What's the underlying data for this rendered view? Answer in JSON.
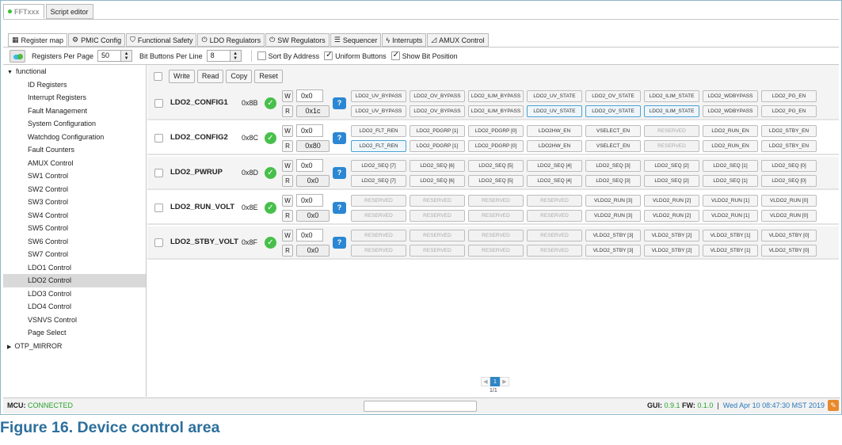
{
  "window": {
    "top_tabs": [
      {
        "label": "Script editor"
      }
    ],
    "top_tab_blurred_label": "FFTxxx"
  },
  "main_tabs": [
    {
      "icon": "grid-icon",
      "label": "Register map"
    },
    {
      "icon": "gear-icon",
      "label": "PMIC Config"
    },
    {
      "icon": "shield-icon",
      "label": "Functional Safety"
    },
    {
      "icon": "power-icon",
      "label": "LDO Regulators"
    },
    {
      "icon": "power-icon",
      "label": "SW Regulators"
    },
    {
      "icon": "list-icon",
      "label": "Sequencer"
    },
    {
      "icon": "lightning-icon",
      "label": "Interrupts"
    },
    {
      "icon": "graph-icon",
      "label": "AMUX Control"
    }
  ],
  "toolbar": {
    "registers_per_page_label": "Registers Per Page",
    "registers_per_page_value": "50",
    "bit_buttons_label": "Bit Buttons Per Line",
    "bit_buttons_value": "8",
    "sort_by_address": "Sort By Address",
    "uniform_buttons": "Uniform Buttons",
    "show_bit_position": "Show Bit Position"
  },
  "tree": {
    "root": "functional",
    "children": [
      "ID Registers",
      "Interrupt Registers",
      "Fault Management",
      "System Configuration",
      "Watchdog Configuration",
      "Fault Counters",
      "AMUX Control",
      "SW1 Control",
      "SW2 Control",
      "SW3 Control",
      "SW4 Control",
      "SW5 Control",
      "SW6 Control",
      "SW7 Control",
      "LDO1 Control",
      "LDO2 Control",
      "LDO3 Control",
      "LDO4 Control",
      "VSNVS Control",
      "Page Select"
    ],
    "selected": "LDO2 Control",
    "root2": "OTP_MIRROR"
  },
  "actions": {
    "write": "Write",
    "read": "Read",
    "copy": "Copy",
    "reset": "Reset"
  },
  "registers": [
    {
      "name": "LDO2_CONFIG1",
      "addr": "0x8B",
      "w": "0x0",
      "r": "0x1c",
      "bits_w": [
        "LDO2_UV_BYPASS",
        "LDO2_OV_BYPASS",
        "LDO2_ILIM_BYPASS",
        "LDO2_UV_STATE",
        "LDO2_OV_STATE",
        "LDO2_ILIM_STATE",
        "LDO2_WDBYPASS",
        "LDO2_PG_EN"
      ],
      "bits_r": [
        "LDO2_UV_BYPASS",
        "LDO2_OV_BYPASS",
        "LDO2_ILIM_BYPASS",
        "LDO2_UV_STATE",
        "LDO2_OV_STATE",
        "LDO2_ILIM_STATE",
        "LDO2_WDBYPASS",
        "LDO2_PG_EN"
      ],
      "hl_r": [
        3,
        4,
        5
      ]
    },
    {
      "name": "LDO2_CONFIG2",
      "addr": "0x8C",
      "w": "0x0",
      "r": "0x80",
      "bits_w": [
        "LDO2_FLT_REN",
        "LDO2_PDGRP [1]",
        "LDO2_PDGRP [0]",
        "LDO2HW_EN",
        "VSELECT_EN",
        "RESERVED",
        "LDO2_RUN_EN",
        "LDO2_STBY_EN"
      ],
      "bits_r": [
        "LDO2_FLT_REN",
        "LDO2_PDGRP [1]",
        "LDO2_PDGRP [0]",
        "LDO2HW_EN",
        "VSELECT_EN",
        "RESERVED",
        "LDO2_RUN_EN",
        "LDO2_STBY_EN"
      ],
      "hl_r": [
        0
      ]
    },
    {
      "name": "LDO2_PWRUP",
      "addr": "0x8D",
      "w": "0x0",
      "r": "0x0",
      "bits_w": [
        "LDO2_SEQ [7]",
        "LDO2_SEQ [6]",
        "LDO2_SEQ [5]",
        "LDO2_SEQ [4]",
        "LDO2_SEQ [3]",
        "LDO2_SEQ [2]",
        "LDO2_SEQ [1]",
        "LDO2_SEQ [0]"
      ],
      "bits_r": [
        "LDO2_SEQ [7]",
        "LDO2_SEQ [6]",
        "LDO2_SEQ [5]",
        "LDO2_SEQ [4]",
        "LDO2_SEQ [3]",
        "LDO2_SEQ [2]",
        "LDO2_SEQ [1]",
        "LDO2_SEQ [0]"
      ],
      "hl_r": []
    },
    {
      "name": "LDO2_RUN_VOLT",
      "addr": "0x8E",
      "w": "0x0",
      "r": "0x0",
      "bits_w": [
        "RESERVED",
        "RESERVED",
        "RESERVED",
        "RESERVED",
        "VLDO2_RUN [3]",
        "VLDO2_RUN [2]",
        "VLDO2_RUN [1]",
        "VLDO2_RUN [0]"
      ],
      "bits_r": [
        "RESERVED",
        "RESERVED",
        "RESERVED",
        "RESERVED",
        "VLDO2_RUN [3]",
        "VLDO2_RUN [2]",
        "VLDO2_RUN [1]",
        "VLDO2_RUN [0]"
      ],
      "hl_r": []
    },
    {
      "name": "LDO2_STBY_VOLT",
      "addr": "0x8F",
      "w": "0x0",
      "r": "0x0",
      "bits_w": [
        "RESERVED",
        "RESERVED",
        "RESERVED",
        "RESERVED",
        "VLDO2_STBY [3]",
        "VLDO2_STBY [2]",
        "VLDO2_STBY [1]",
        "VLDO2_STBY [0]"
      ],
      "bits_r": [
        "RESERVED",
        "RESERVED",
        "RESERVED",
        "RESERVED",
        "VLDO2_STBY [3]",
        "VLDO2_STBY [2]",
        "VLDO2_STBY [1]",
        "VLDO2_STBY [0]"
      ],
      "hl_r": []
    }
  ],
  "pager": {
    "current": "1",
    "count": "1/1"
  },
  "status": {
    "mcu_label": "MCU:",
    "mcu_value": "CONNECTED",
    "gui_label": "GUI:",
    "gui_value": "0.9.1",
    "fw_label": "FW:",
    "fw_value": "0.1.0",
    "datetime": "Wed Apr 10 08:47:30 MST 2019"
  },
  "caption": "Figure 16.  Device control area"
}
